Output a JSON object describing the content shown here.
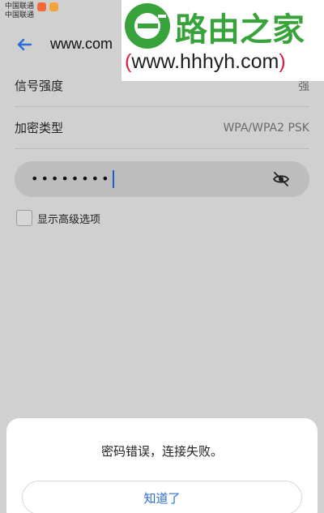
{
  "status_bar": {
    "carrier1": "中国联通",
    "carrier2": "中国联通"
  },
  "header": {
    "title": "www.com"
  },
  "watermark": {
    "brand": "路由之家",
    "url": "www.hhhyh.com",
    "open_paren": "(",
    "close_paren": ")"
  },
  "details": {
    "signal_label": "信号强度",
    "signal_value": "强",
    "encryption_label": "加密类型",
    "encryption_value": "WPA/WPA2 PSK"
  },
  "password": {
    "masked": "••••••••"
  },
  "advanced": {
    "label": "显示高级选项"
  },
  "dialog": {
    "message": "密码错误，连接失败。",
    "button": "知道了"
  },
  "colors": {
    "dialog_button_text": "#2b6fd6",
    "header_arrow": "#2b6fd6",
    "watermark_green": "#38a33b",
    "watermark_red": "#d81e3a"
  }
}
